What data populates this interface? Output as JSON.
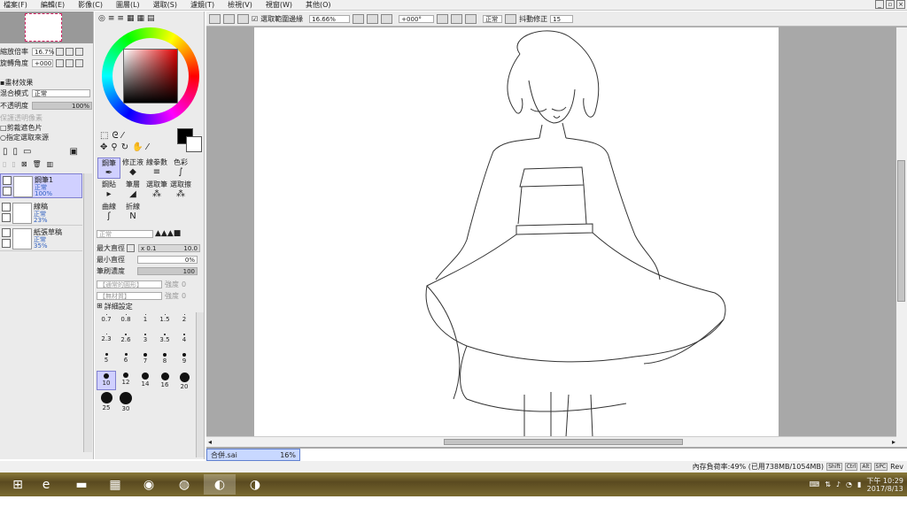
{
  "menu": [
    "檔案(F)",
    "編輯(E)",
    "影像(C)",
    "圖層(L)",
    "選取(S)",
    "濾鏡(T)",
    "檢視(V)",
    "視窗(W)",
    "其他(O)"
  ],
  "navigator": {
    "zoom_label": "縮放倍率",
    "zoom_value": "16.7%",
    "angle_label": "旋轉角度",
    "angle_value": "+000"
  },
  "layer_effect": {
    "title": "畫材效果",
    "blend_label": "混合模式",
    "blend_value": "正常",
    "opacity_label": "不透明度",
    "opacity_value": "100%",
    "lock_alpha": "保護透明像素",
    "clip": "剪裁遮色片",
    "selection_source": "指定選取來源"
  },
  "layers": [
    {
      "name": "鋼筆1",
      "mode": "正常",
      "opacity": "100%",
      "selected": true
    },
    {
      "name": "線稿",
      "mode": "正常",
      "opacity": "23%",
      "selected": false
    },
    {
      "name": "紙張草稿",
      "mode": "正常",
      "opacity": "35%",
      "selected": false
    }
  ],
  "tools": [
    "鋼筆",
    "修正液",
    "線拳數",
    "色彩",
    "鋼貼",
    "筆層",
    "選取筆",
    "選取擦",
    "曲線",
    "折線"
  ],
  "brush": {
    "mode": "正常",
    "max_label": "最大直徑",
    "max_mult": "x 0.1",
    "max_value": "10.0",
    "min_label": "最小直徑",
    "min_value": "0%",
    "density_label": "筆刷濃度",
    "density_value": "100",
    "tex1": "【通常的圓形】",
    "tex1_label": "強度",
    "tex1_value": "0",
    "tex2": "【無材質】",
    "tex2_label": "強度",
    "tex2_value": "0",
    "detail_label": "詳細設定"
  },
  "brush_sizes": [
    "0.7",
    "0.8",
    "1",
    "1.5",
    "2",
    "2.3",
    "2.6",
    "3",
    "3.5",
    "4",
    "5",
    "6",
    "7",
    "8",
    "9",
    "10",
    "12",
    "14",
    "16",
    "20",
    "25",
    "30"
  ],
  "canvas_toolbar": {
    "antialias_label": "選取範圍邊緣",
    "zoom": "16.66%",
    "angle": "+000°",
    "blend": "正常",
    "stab_label": "抖動修正",
    "stab_value": "15"
  },
  "file_tab": {
    "name": "合併.sai",
    "zoom": "16%"
  },
  "status": {
    "memory": "內存負荷率:49% (已用738MB/1054MB)",
    "keys": [
      "Shift",
      "Ctrl",
      "Alt",
      "SPC"
    ],
    "rev": "Rev"
  },
  "taskbar": {
    "apps": [
      "ie-icon",
      "explorer-icon",
      "store-icon",
      "chrome-icon",
      "browser-icon",
      "sai-icon",
      "media-icon"
    ],
    "time": "下午 10:29",
    "date": "2017/8/13"
  }
}
